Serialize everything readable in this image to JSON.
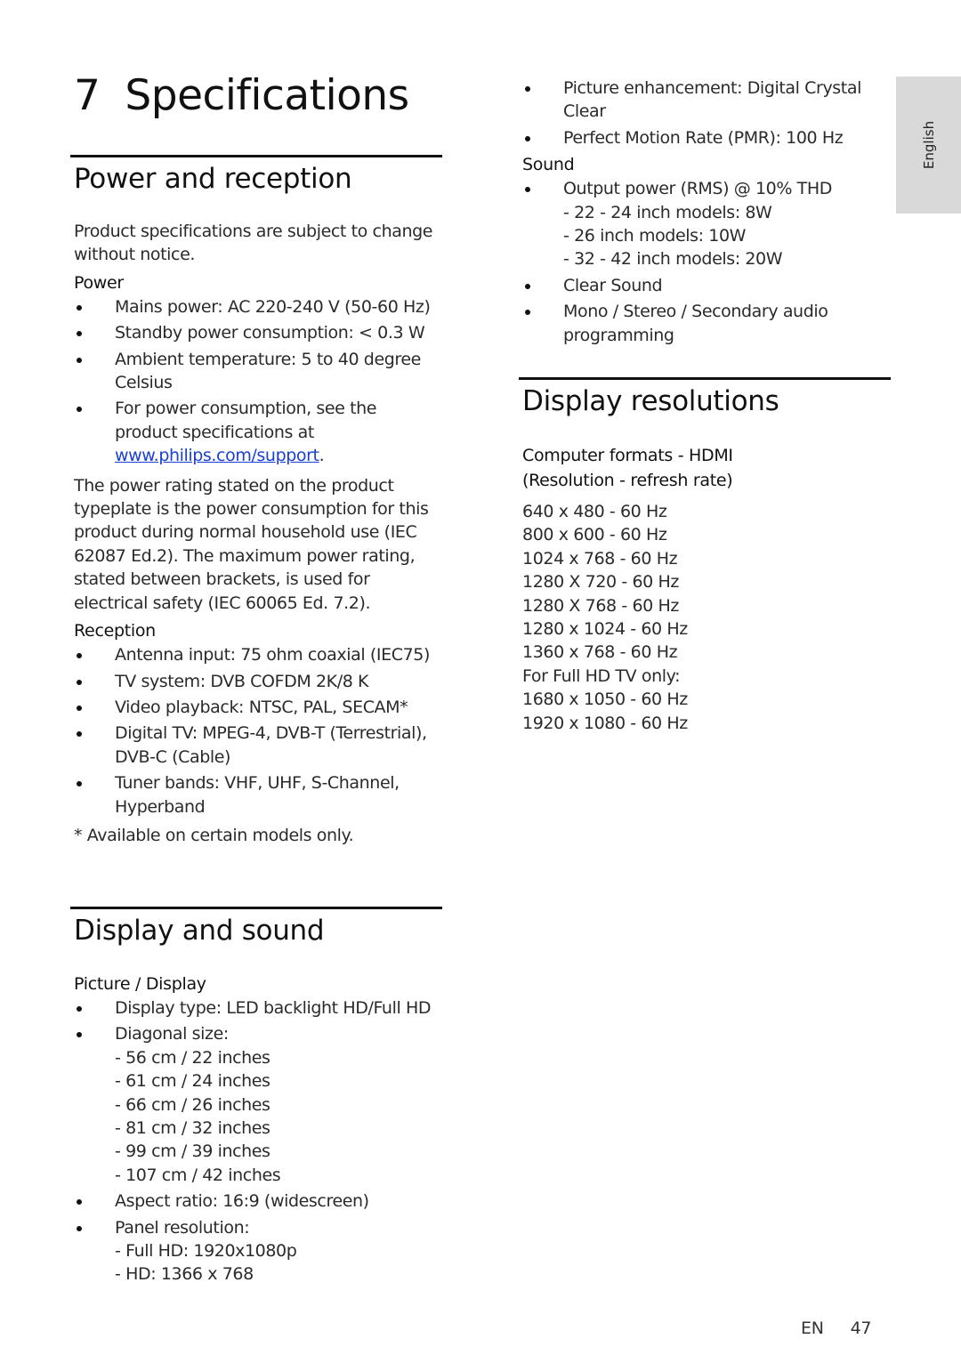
{
  "chapter": {
    "number": "7",
    "title": "Specifications"
  },
  "language_tab": "English",
  "footer": {
    "lang": "EN",
    "page": "47"
  },
  "power_reception": {
    "title": "Power and reception",
    "intro": "Product specifications are subject to change without notice.",
    "power": {
      "heading": "Power",
      "items": [
        "Mains power: AC 220-240 V (50-60 Hz)",
        "Standby power consumption: < 0.3 W",
        "Ambient temperature: 5 to 40 degree Celsius"
      ],
      "consumption_prefix": "For power consumption, see the product specifications at ",
      "consumption_link": "www.philips.com/support",
      "consumption_suffix": "."
    },
    "rating_note": "The power rating stated on the product typeplate is the power consumption for this product during normal household use (IEC 62087 Ed.2). The maximum power rating, stated between brackets, is used for electrical safety (IEC 60065 Ed. 7.2).",
    "reception": {
      "heading": "Reception",
      "items": [
        "Antenna input: 75 ohm coaxial (IEC75)",
        "TV system: DVB COFDM 2K/8 K",
        "Video playback: NTSC, PAL, SECAM*",
        "Digital TV: MPEG-4, DVB-T (Terrestrial), DVB-C (Cable)",
        "Tuner bands: VHF, UHF, S-Channel, Hyperband"
      ],
      "footnote": "* Available on certain models only."
    }
  },
  "display_sound": {
    "title": "Display and sound",
    "picture": {
      "heading": "Picture / Display",
      "display_type": "Display type: LED backlight HD/Full HD",
      "diagonal_label": "Diagonal size:",
      "diagonal_sizes": [
        "- 56 cm / 22 inches",
        "- 61 cm / 24 inches",
        "- 66 cm / 26 inches",
        "- 81 cm / 32 inches",
        "- 99 cm / 39 inches",
        "- 107 cm / 42 inches"
      ],
      "aspect_ratio": "Aspect ratio: 16:9 (widescreen)",
      "panel_label": "Panel resolution:",
      "panel_resolutions": [
        "- Full HD: 1920x1080p",
        "- HD: 1366 x 768"
      ],
      "enhancement": "Picture enhancement: Digital Crystal Clear",
      "pmr": "Perfect Motion Rate (PMR): 100 Hz"
    },
    "sound": {
      "heading": "Sound",
      "output_label": "Output power (RMS) @ 10% THD",
      "output_levels": [
        "- 22 - 24 inch models: 8W",
        "- 26 inch models: 10W",
        "- 32 - 42 inch models: 20W"
      ],
      "clear_sound": "Clear Sound",
      "audio_modes": "Mono / Stereo / Secondary audio programming"
    }
  },
  "display_resolutions": {
    "title": "Display resolutions",
    "subheading": "Computer formats - HDMI (Resolution - refresh rate)",
    "rows": [
      "640 x 480 - 60 Hz",
      "800 x 600 - 60 Hz",
      "1024 x 768 - 60 Hz",
      "1280 X 720 - 60 Hz",
      "1280 X 768 - 60 Hz",
      "1280 x 1024 - 60 Hz",
      "1360 x 768 - 60 Hz",
      "For Full HD TV only:",
      "1680 x 1050 - 60 Hz",
      "1920 x 1080 - 60 Hz"
    ]
  }
}
